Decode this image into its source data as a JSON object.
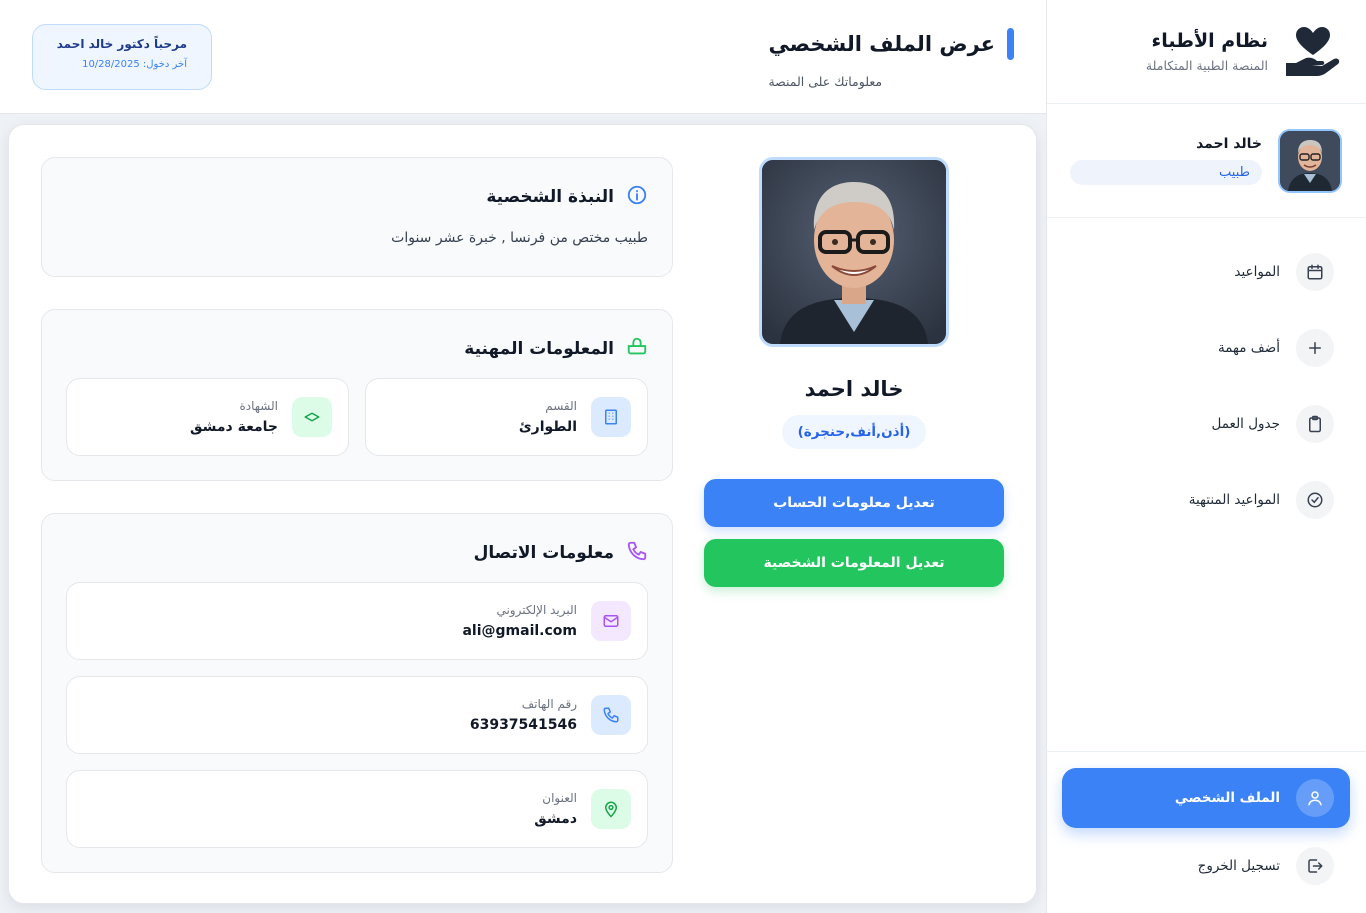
{
  "sidebar": {
    "brand_title": "نظام الأطباء",
    "brand_subtitle": "المنصة الطبية المتكاملة",
    "user_name": "خالد احمد",
    "user_role": "طبيب",
    "items": [
      {
        "label": "المواعيد",
        "icon": "calendar-icon"
      },
      {
        "label": "أضف مهمة",
        "icon": "plus-icon"
      },
      {
        "label": "جدول العمل",
        "icon": "clipboard-icon"
      },
      {
        "label": "المواعيد المنتهية",
        "icon": "check-circle-icon"
      }
    ],
    "profile_label": "الملف الشخصي",
    "logout_label": "تسجيل الخروج"
  },
  "header": {
    "title": "عرض الملف الشخصي",
    "subtitle": "معلوماتك على المنصة",
    "welcome": "مرحباً دكتور خالد احمد",
    "last_login": "آخر دخول: 10/28/2025"
  },
  "profile": {
    "name": "خالد احمد",
    "specialty": "(أذن,أنف,حنجرة)",
    "edit_account": "تعديل معلومات الحساب",
    "edit_personal": "تعديل المعلومات الشخصية"
  },
  "bio": {
    "title": "النبذة الشخصية",
    "text": "طبيب مختص من فرنسا , خبرة عشر سنوات"
  },
  "professional": {
    "title": "المعلومات المهنية",
    "department_label": "القسم",
    "department_value": "الطوارئ",
    "certificate_label": "الشهادة",
    "certificate_value": "جامعة دمشق"
  },
  "contact": {
    "title": "معلومات الاتصال",
    "email_label": "البريد الإلكتروني",
    "email_value": "ali@gmail.com",
    "phone_label": "رقم الهاتف",
    "phone_value": "63937541546",
    "address_label": "العنوان",
    "address_value": "دمشق"
  },
  "colors": {
    "primary": "#3b82f6",
    "success": "#22c55e",
    "purple": "#a855f7"
  }
}
